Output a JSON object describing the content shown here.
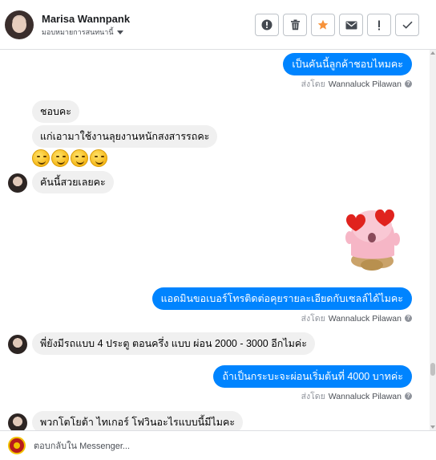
{
  "header": {
    "contact_name": "Marisa Wannpank",
    "assign_label": "มอบหมายการสนทนานี้"
  },
  "toolbar": [
    {
      "name": "spam-button",
      "icon": "alert-circle-icon"
    },
    {
      "name": "delete-button",
      "icon": "trash-icon"
    },
    {
      "name": "star-button",
      "icon": "star-icon"
    },
    {
      "name": "mark-unread-button",
      "icon": "envelope-icon"
    },
    {
      "name": "report-button",
      "icon": "exclamation-icon"
    },
    {
      "name": "done-button",
      "icon": "checkmark-icon"
    }
  ],
  "colors": {
    "outgoing_bubble": "#0084ff",
    "incoming_bubble": "#f0f0f0",
    "star": "#f7923a"
  },
  "messages": {
    "m1": {
      "text": "เป็นคันนี้ลูกค้าชอบไหมคะ",
      "sent_by_prefix": "ส่งโดย",
      "sent_by_name": "Wannaluck Pilawan"
    },
    "m2": {
      "text": "ชอบคะ"
    },
    "m3": {
      "text": "แก่เอามาใช้งานลุยงานหนักสงสารรถคะ"
    },
    "m4": {
      "emoji": [
        "smirk-emoji",
        "smirk-emoji",
        "smirk-emoji",
        "smirk-emoji"
      ]
    },
    "m5": {
      "text": "คันนี้สวยเลยคะ"
    },
    "m6": {
      "sticker": "pink-blob-heart-eyes-sticker"
    },
    "m7": {
      "text": "แอดมินขอเบอร์โทรติดต่อคุยรายละเอียดกับเซลล์ได้ไมคะ",
      "sent_by_prefix": "ส่งโดย",
      "sent_by_name": "Wannaluck Pilawan"
    },
    "m8": {
      "text": "พี่ยังมีรถแบบ 4 ประตู ตอนครึ่ง แบบ ผ่อน 2000 - 3000 อีกไมค่ะ"
    },
    "m9": {
      "text": "ถ้าเป็นกระบะจะผ่อนเริ่มต้นที่ 4000 บาทค่ะ",
      "sent_by_prefix": "ส่งโดย",
      "sent_by_name": "Wannaluck Pilawan"
    },
    "m10": {
      "text": "พวกโตโยต้า ไทเกอร์ โฟวินอะไรแบบนี้มีไมคะ"
    }
  },
  "footer": {
    "reply_placeholder": "ตอบกลับใน Messenger..."
  }
}
